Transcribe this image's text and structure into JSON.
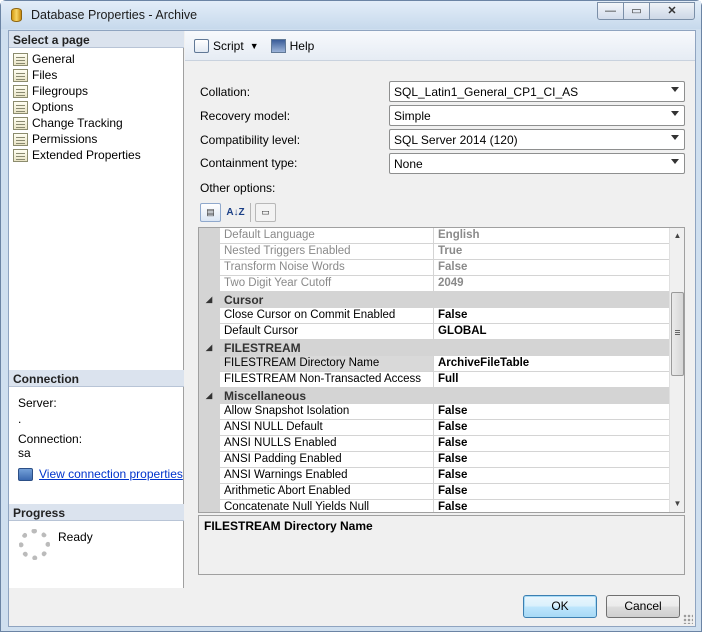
{
  "window": {
    "title": "Database Properties - Archive",
    "minimize_glyph": "—",
    "maximize_glyph": "▭",
    "close_glyph": "✕"
  },
  "sidebar": {
    "select_page_title": "Select a page",
    "pages": [
      {
        "label": "General",
        "icon": "page-icon"
      },
      {
        "label": "Files",
        "icon": "page-icon"
      },
      {
        "label": "Filegroups",
        "icon": "page-icon"
      },
      {
        "label": "Options",
        "icon": "page-icon"
      },
      {
        "label": "Change Tracking",
        "icon": "page-icon"
      },
      {
        "label": "Permissions",
        "icon": "page-icon"
      },
      {
        "label": "Extended Properties",
        "icon": "page-icon"
      }
    ],
    "connection_title": "Connection",
    "server_label": "Server:",
    "server_value": ".",
    "connection_label": "Connection:",
    "connection_value": "sa",
    "view_connection_link": "View connection properties",
    "progress_title": "Progress",
    "progress_status": "Ready"
  },
  "toolbar": {
    "script_label": "Script",
    "help_label": "Help"
  },
  "options": {
    "collation_label": "Collation:",
    "collation_value": "SQL_Latin1_General_CP1_CI_AS",
    "recovery_label": "Recovery model:",
    "recovery_value": "Simple",
    "compat_label": "Compatibility level:",
    "compat_value": "SQL Server 2014 (120)",
    "containment_label": "Containment type:",
    "containment_value": "None",
    "other_options_label": "Other options:"
  },
  "grid": {
    "sort_az_label": "A↓Z",
    "rows": [
      {
        "kind": "row",
        "name": "Default Language",
        "value": "English",
        "dim": true
      },
      {
        "kind": "row",
        "name": "Nested Triggers Enabled",
        "value": "True",
        "dim": true
      },
      {
        "kind": "row",
        "name": "Transform Noise Words",
        "value": "False",
        "dim": true
      },
      {
        "kind": "row",
        "name": "Two Digit Year Cutoff",
        "value": "2049",
        "dim": true
      },
      {
        "kind": "category",
        "name": "Cursor"
      },
      {
        "kind": "row",
        "name": "Close Cursor on Commit Enabled",
        "value": "False"
      },
      {
        "kind": "row",
        "name": "Default Cursor",
        "value": "GLOBAL"
      },
      {
        "kind": "category",
        "name": "FILESTREAM"
      },
      {
        "kind": "row",
        "name": "FILESTREAM Directory Name",
        "value": "ArchiveFileTable",
        "selected": true
      },
      {
        "kind": "row",
        "name": "FILESTREAM Non-Transacted Access",
        "value": "Full"
      },
      {
        "kind": "category",
        "name": "Miscellaneous"
      },
      {
        "kind": "row",
        "name": "Allow Snapshot Isolation",
        "value": "False"
      },
      {
        "kind": "row",
        "name": "ANSI NULL Default",
        "value": "False"
      },
      {
        "kind": "row",
        "name": "ANSI NULLS Enabled",
        "value": "False"
      },
      {
        "kind": "row",
        "name": "ANSI Padding Enabled",
        "value": "False"
      },
      {
        "kind": "row",
        "name": "ANSI Warnings Enabled",
        "value": "False"
      },
      {
        "kind": "row",
        "name": "Arithmetic Abort Enabled",
        "value": "False"
      },
      {
        "kind": "row",
        "name": "Concatenate Null Yields Null",
        "value": "False"
      }
    ]
  },
  "description": {
    "title": "FILESTREAM Directory Name"
  },
  "buttons": {
    "ok": "OK",
    "cancel": "Cancel"
  }
}
